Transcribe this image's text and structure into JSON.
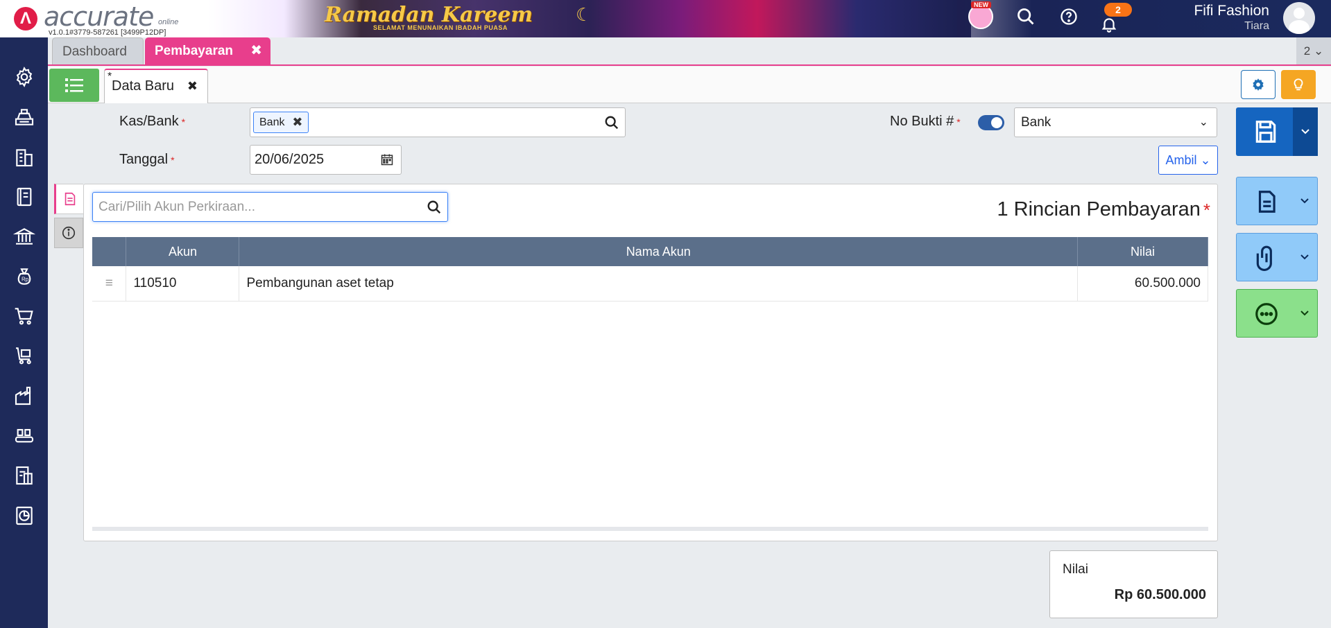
{
  "header": {
    "app_name": "accurate",
    "app_suffix": "online",
    "version": "v1.0.1#3779-587261 [3499P12DP]",
    "banner_title": "Ramadan Kareem",
    "banner_subtitle": "SELAMAT MENUNAIKAN IBADAH PUASA",
    "new_badge": "NEW",
    "notification_count": "2",
    "company_name": "Fifi Fashion",
    "user_name": "Tiara"
  },
  "tabs": [
    {
      "label": "Dashboard"
    },
    {
      "label": "Pembayaran"
    }
  ],
  "tab_count": "2",
  "subtab": {
    "star": "*",
    "label": "Data Baru"
  },
  "form": {
    "kas_bank_label": "Kas/Bank",
    "kas_bank_value": "Bank",
    "tanggal_label": "Tanggal",
    "tanggal_value": "20/06/2025",
    "no_bukti_label": "No Bukti #",
    "no_bukti_value": "Bank",
    "ambil_label": "Ambil",
    "required_mark": "*"
  },
  "details": {
    "search_placeholder": "Cari/Pilih Akun Perkiraan...",
    "title": "1 Rincian Pembayaran",
    "columns": [
      "Akun",
      "Nama Akun",
      "Nilai"
    ],
    "rows": [
      {
        "akun": "110510",
        "nama": "Pembangunan aset tetap",
        "nilai": "60.500.000"
      }
    ]
  },
  "total": {
    "label": "Nilai",
    "value": "Rp 60.500.000"
  },
  "colors": {
    "accent_pink": "#e83e8c",
    "sidebar": "#1e2a5a",
    "grid_header": "#5b6f8a",
    "primary_blue": "#1565c0"
  }
}
